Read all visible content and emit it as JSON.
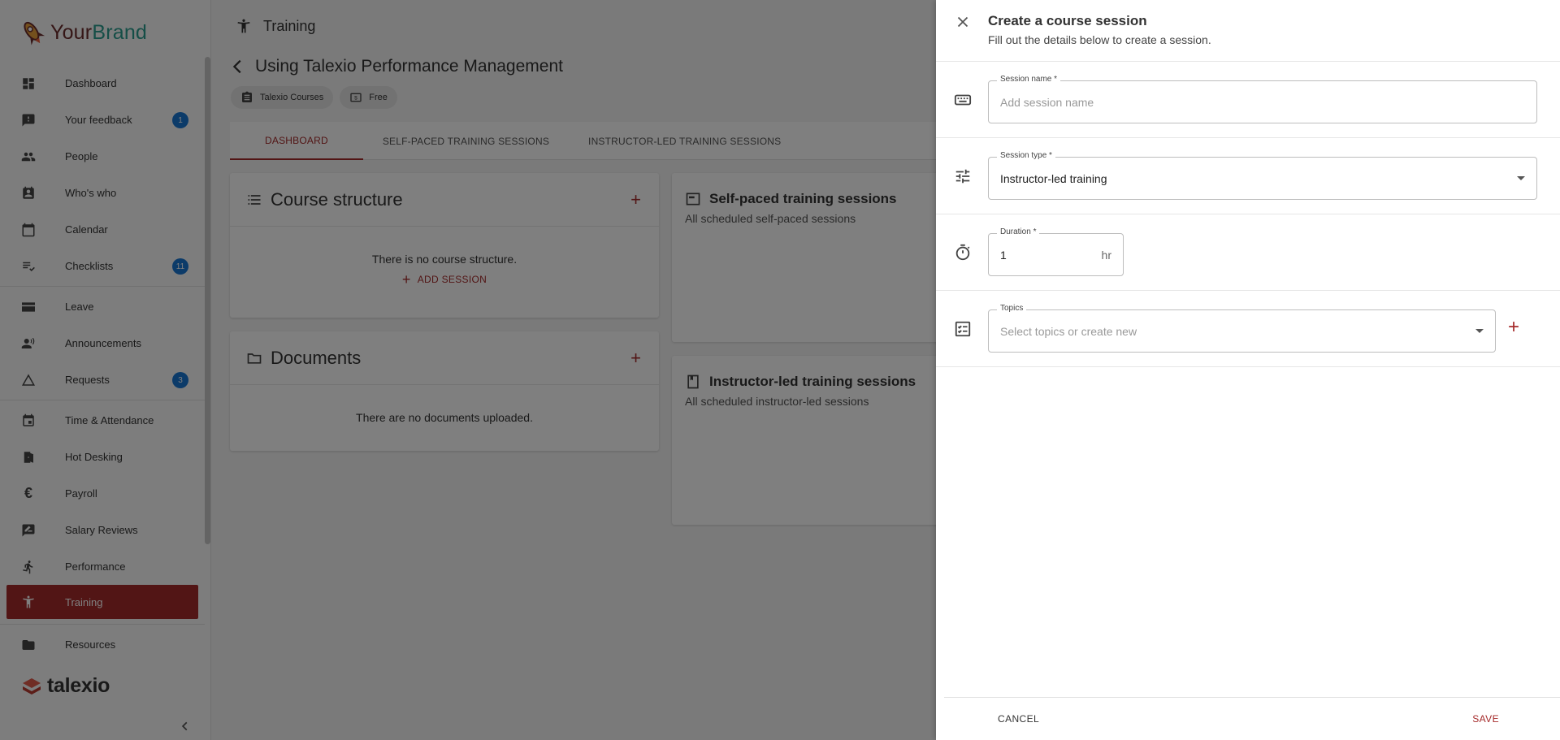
{
  "brand": {
    "name_part1": "Your",
    "name_part2": "Brand"
  },
  "sidebar": {
    "items": [
      {
        "label": "Dashboard",
        "icon": "dashboard-icon"
      },
      {
        "label": "Your feedback",
        "icon": "feedback-icon",
        "badge": "1"
      },
      {
        "label": "People",
        "icon": "people-icon"
      },
      {
        "label": "Who's who",
        "icon": "contact-icon"
      },
      {
        "label": "Calendar",
        "icon": "calendar-icon"
      },
      {
        "label": "Checklists",
        "icon": "checklist-icon",
        "badge": "11"
      },
      {
        "label": "Leave",
        "icon": "leave-icon"
      },
      {
        "label": "Announcements",
        "icon": "announcement-icon"
      },
      {
        "label": "Requests",
        "icon": "requests-icon",
        "badge": "3"
      },
      {
        "label": "Time & Attendance",
        "icon": "time-attendance-icon"
      },
      {
        "label": "Hot Desking",
        "icon": "hot-desking-icon"
      },
      {
        "label": "Payroll",
        "icon": "euro-icon"
      },
      {
        "label": "Salary Reviews",
        "icon": "salary-review-icon"
      },
      {
        "label": "Performance",
        "icon": "performance-icon"
      },
      {
        "label": "Training",
        "icon": "training-icon",
        "active": true
      },
      {
        "label": "Resources",
        "icon": "folder-icon"
      }
    ],
    "footer_logo": "talexio"
  },
  "topbar": {
    "title": "Training"
  },
  "course": {
    "title": "Using Talexio Performance Management",
    "chips": [
      "Talexio Courses",
      "Free"
    ]
  },
  "tabs": [
    "DASHBOARD",
    "SELF-PACED TRAINING SESSIONS",
    "INSTRUCTOR-LED TRAINING SESSIONS"
  ],
  "cards": {
    "structure": {
      "title": "Course structure",
      "empty": "There is no course structure.",
      "add_session": "ADD SESSION"
    },
    "documents": {
      "title": "Documents",
      "empty": "There are no documents uploaded."
    },
    "self_paced": {
      "title": "Self-paced training sessions",
      "subtitle": "All scheduled self-paced sessions"
    },
    "instructor": {
      "title": "Instructor-led training sessions",
      "subtitle": "All scheduled instructor-led sessions"
    }
  },
  "drawer": {
    "title": "Create a course session",
    "subtitle": "Fill out the details below to create a session.",
    "fields": {
      "session_name": {
        "label": "Session name *",
        "placeholder": "Add session name",
        "value": ""
      },
      "session_type": {
        "label": "Session type *",
        "value": "Instructor-led training"
      },
      "duration": {
        "label": "Duration *",
        "value": "1",
        "unit": "hr"
      },
      "topics": {
        "label": "Topics",
        "placeholder": "Select topics or create new"
      }
    },
    "cancel": "CANCEL",
    "save": "SAVE"
  },
  "colors": {
    "accent": "#a52a2a",
    "badge": "#1976d2",
    "brand_teal": "#2a9d8f"
  }
}
